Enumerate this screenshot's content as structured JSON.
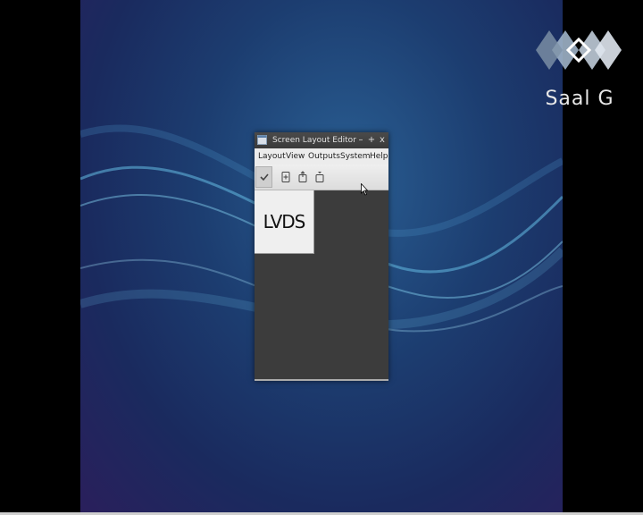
{
  "window": {
    "title": "Screen Layout Editor",
    "minimize": "–",
    "maximize": "+",
    "close": "x"
  },
  "menubar": {
    "items": [
      {
        "label": "Layout"
      },
      {
        "label": "View"
      },
      {
        "label": "Outputs"
      },
      {
        "label": "System"
      },
      {
        "label": "Help"
      }
    ]
  },
  "toolbar": {
    "buttons": [
      {
        "icon": "checkmark-icon"
      },
      {
        "icon": "zoom-in-icon"
      },
      {
        "icon": "export-icon"
      },
      {
        "icon": "import-icon"
      }
    ]
  },
  "canvas": {
    "output_label": "LVDS"
  },
  "watermark": {
    "text": "Saal G"
  },
  "colors": {
    "desktop_bg": "#1c3d70",
    "window_bg": "#3c3c3c",
    "menubar_bg": "#ececec"
  }
}
